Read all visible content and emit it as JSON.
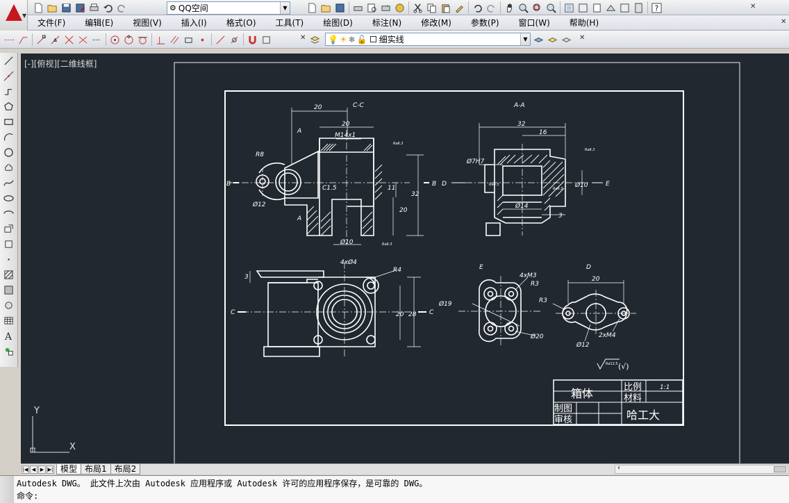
{
  "toolbar_top": {
    "workspace_value": "QQ空间",
    "workspace_icon": "gear-icon"
  },
  "menu": [
    "文件(F)",
    "编辑(E)",
    "视图(V)",
    "插入(I)",
    "格式(O)",
    "工具(T)",
    "绘图(D)",
    "标注(N)",
    "修改(M)",
    "参数(P)",
    "窗口(W)",
    "帮助(H)"
  ],
  "toolbar_layer": {
    "linetype_value": "细实线"
  },
  "viewport": {
    "label": "[-][俯视][二维线框]",
    "axis_y": "Y",
    "axis_x": "X",
    "background": "#212830"
  },
  "layout_tabs": [
    "模型",
    "布局1",
    "布局2"
  ],
  "active_tab": "模型",
  "command": {
    "history": "Autodesk DWG。  此文件上次由 Autodesk 应用程序或 Autodesk 许可的应用程序保存，是可靠的 DWG。",
    "prompt": "命令:"
  },
  "drawing": {
    "section_cc": "C-C",
    "section_aa": "A-A",
    "view_e": "E",
    "view_d": "D",
    "dims": {
      "d20_top": "20",
      "d20_inner": "20",
      "m14": "M14x1",
      "r8": "R8",
      "c15": "C1.5",
      "phi12": "Ø12",
      "phi10": "Ø10",
      "d11": "11",
      "d20_v": "20",
      "d32_v": "32",
      "aa_32": "32",
      "aa_16": "16",
      "aa_phi7": "Ø7H7",
      "aa_phi14": "Ø14",
      "aa_phi10": "Ø10",
      "aa_3": "3",
      "pv_4phi4": "4xØ4",
      "pv_r4": "R4",
      "pv_20": "20",
      "pv_28": "28",
      "pv_3": "3",
      "e_4m3": "4xM3",
      "e_r3": "R3",
      "e_phi19": "Ø19",
      "e_phi20": "Ø20",
      "d_20": "20",
      "d_r3": "R3",
      "d_phi12": "Ø12",
      "d_2m4": "2xM4",
      "rough1": "Ra6.3",
      "rough2": "Ra3.2",
      "rough_general": "Ra12.5",
      "rough_suffix": "(√)",
      "label_a": "A",
      "label_b": "B",
      "label_c": "C",
      "label_d": "D",
      "label_e": "E"
    },
    "title_block": {
      "part_name": "箱体",
      "scale_label": "比例",
      "scale_value": "1:1",
      "material_label": "材料",
      "drawn_label": "制图",
      "checked_label": "审核",
      "school": "哈工大"
    }
  }
}
